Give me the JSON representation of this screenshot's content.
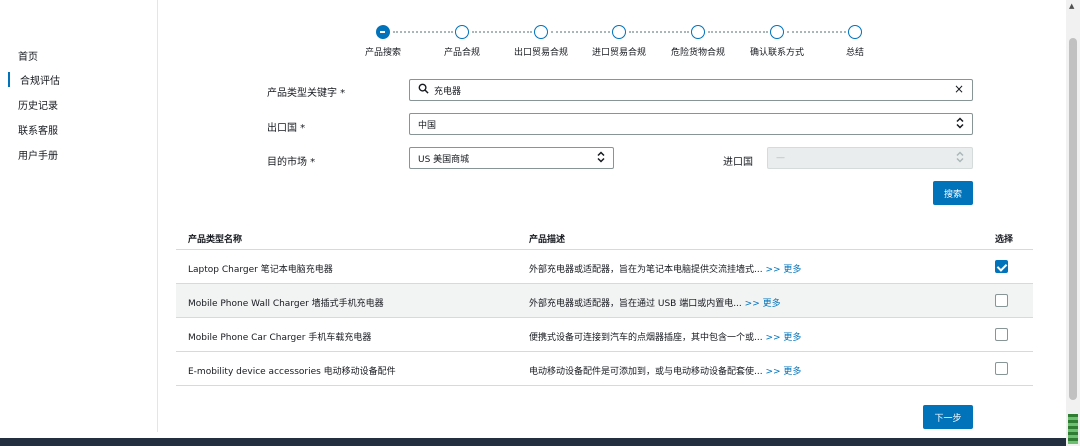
{
  "sidebar": {
    "items": [
      {
        "label": "首页",
        "active": false
      },
      {
        "label": "合规评估",
        "active": true
      },
      {
        "label": "历史记录",
        "active": false
      },
      {
        "label": "联系客服",
        "active": false
      },
      {
        "label": "用户手册",
        "active": false
      }
    ]
  },
  "stepper": {
    "current_index": 0,
    "steps": [
      "产品搜索",
      "产品合规",
      "出口贸易合规",
      "进口贸易合规",
      "危险货物合规",
      "确认联系方式",
      "总结"
    ]
  },
  "form": {
    "keyword_label": "产品类型关键字 *",
    "keyword_value": "充电器",
    "clear_icon": "×",
    "export_label": "出口国 *",
    "export_value": "中国",
    "market_label": "目的市场 *",
    "market_value": "US 美国商城",
    "import_label": "进口国",
    "import_value": "—",
    "search_button": "搜索"
  },
  "table": {
    "headers": {
      "name": "产品类型名称",
      "desc": "产品描述",
      "select": "选择"
    },
    "rows": [
      {
        "name": "Laptop Charger 笔记本电脑充电器",
        "desc": "外部充电器或适配器，旨在为笔记本电脑提供交流挂墙式...",
        "more": ">> 更多",
        "checked": true
      },
      {
        "name": "Mobile Phone Wall Charger 墙插式手机充电器",
        "desc": "外部充电器或适配器，旨在通过 USB 端口或内置电...",
        "more": ">> 更多",
        "checked": false
      },
      {
        "name": "Mobile Phone Car Charger 手机车载充电器",
        "desc": "便携式设备可连接到汽车的点烟器插座，其中包含一个或...",
        "more": ">> 更多",
        "checked": false
      },
      {
        "name": "E-mobility device accessories 电动移动设备配件",
        "desc": "电动移动设备配件是可添加到，或与电动移动设备配套使...",
        "more": ">> 更多",
        "checked": false
      }
    ]
  },
  "next_button": "下一步",
  "colors": {
    "accent": "#0073bb",
    "footer": "#232f3e"
  }
}
